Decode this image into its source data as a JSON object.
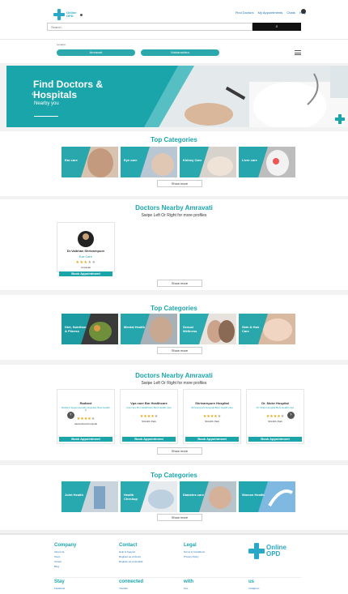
{
  "header": {
    "logo_line1": "Online",
    "logo_line2": "OPD",
    "nav": [
      "Find Doctors",
      "My Appointments",
      "Chats",
      "Help"
    ],
    "search_placeholder": "Search",
    "search_button": "⌕"
  },
  "location": {
    "label": "Location",
    "city": "Amravati",
    "state": "Maharashtra"
  },
  "hero": {
    "title_line1": "Find Doctors &",
    "title_line2": "Hospitals",
    "subtitle": "Nearby you",
    "chevron": "‹"
  },
  "categories1": {
    "title": "Top Categories",
    "items": [
      "Ear care",
      "Eye care",
      "Kidney Care",
      "Liver care"
    ],
    "show_more": "Show more"
  },
  "doctors": {
    "title": "Doctors Nearby Amravati",
    "subtitle": "Swipe Left Or Right for more profiles",
    "cards": [
      {
        "name": "Dr.Vaibhav Shrivarnpure",
        "speciality": "Ear Care",
        "location": "Amravati",
        "rating": 3,
        "book": "Book Appointment"
      }
    ],
    "show_more": "Show more"
  },
  "categories2": {
    "title": "Top Categories",
    "items": [
      "Diet, Nutrition & Fitness",
      "Mental Health",
      "Sexual Wellness",
      "Skin & Hair Care"
    ],
    "show_more": "Show more"
  },
  "hospitals": {
    "title": "Doctors Nearby Amravati",
    "subtitle": "Swipe Left Or Right for more profiles",
    "cards": [
      {
        "name": "Radiant",
        "desc": "Radiant Superspecialty Hospital, Best Health in",
        "location": "Akola Road Amravati",
        "rating": 4,
        "book": "Book Appointment"
      },
      {
        "name": "Vpa care Bm Healthcare",
        "desc": "Vpa care Bm Healthcare Best Health care",
        "location": "Shivtirth Park",
        "rating": 4,
        "book": "Book Appointment"
      },
      {
        "name": "Shrivarnpure Hospital",
        "desc": "Shrivarnpure Hospital Best Health care",
        "location": "Shivtirth Park",
        "rating": 4,
        "book": "Book Appointment"
      },
      {
        "name": "Dr. Muke Hospital",
        "desc": "Dr. Muke Hospital Best Health care",
        "location": "Shivtirth Park",
        "rating": 4,
        "book": "Book Appointment"
      }
    ],
    "prev": "‹",
    "next": "›",
    "show_more": "Show more"
  },
  "categories3": {
    "title": "Top Categories",
    "items": [
      "Joint Health",
      "Health Checkup",
      "Diabetes care",
      "Women Health"
    ],
    "show_more": "Show more"
  },
  "footer": {
    "company": {
      "head": "Company",
      "links": [
        "About Us",
        "Team",
        "Career",
        "Blog"
      ]
    },
    "contact": {
      "head": "Contact",
      "links": [
        "Help & Support",
        "Register as a Doctor",
        "Register as a Hospital"
      ]
    },
    "legal": {
      "head": "Legal",
      "links": [
        "Terms & Conditions",
        "Privacy Policy"
      ]
    },
    "logo_line1": "Online",
    "logo_line2": "OPD",
    "social": [
      {
        "head": "Stay",
        "link": "Facebook"
      },
      {
        "head": "connected",
        "link": "Youtube"
      },
      {
        "head": "with",
        "link": "Koo"
      },
      {
        "head": "us",
        "link": "Instagram"
      }
    ]
  },
  "colors": {
    "accent": "#1aa5ab",
    "brand_blue": "#2aa8c9"
  }
}
